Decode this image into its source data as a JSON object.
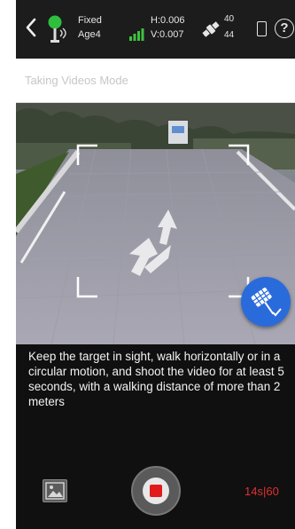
{
  "status_bar": {
    "fix_status": "Fixed",
    "age": "Age4",
    "h_precision": "H:0.006",
    "v_precision": "V:0.007",
    "satellites_used": "40",
    "satellites_visible": "44",
    "icons": [
      "back-icon",
      "rtk-receiver-icon",
      "signal-bars-icon",
      "satellite-icon",
      "device-icon",
      "help-icon"
    ],
    "help_glyph": "?"
  },
  "mode_bar": {
    "label": "Taking Videos Mode"
  },
  "instructions": {
    "text": "Keep the target in sight, walk horizontally or in a circular motion, and shoot the video for at least 5 seconds, with a walking distance of more than 2 meters"
  },
  "controls": {
    "timer": "14s|60",
    "icons": [
      "gallery-icon",
      "record-icon",
      "mode-fab-icon"
    ]
  },
  "colors": {
    "accent_blue": "#2a6bdc",
    "record_red": "#e01b1b",
    "timer_red": "#e03030",
    "signal_green": "#3ec23e",
    "rtk_green": "#2fbf3f"
  }
}
